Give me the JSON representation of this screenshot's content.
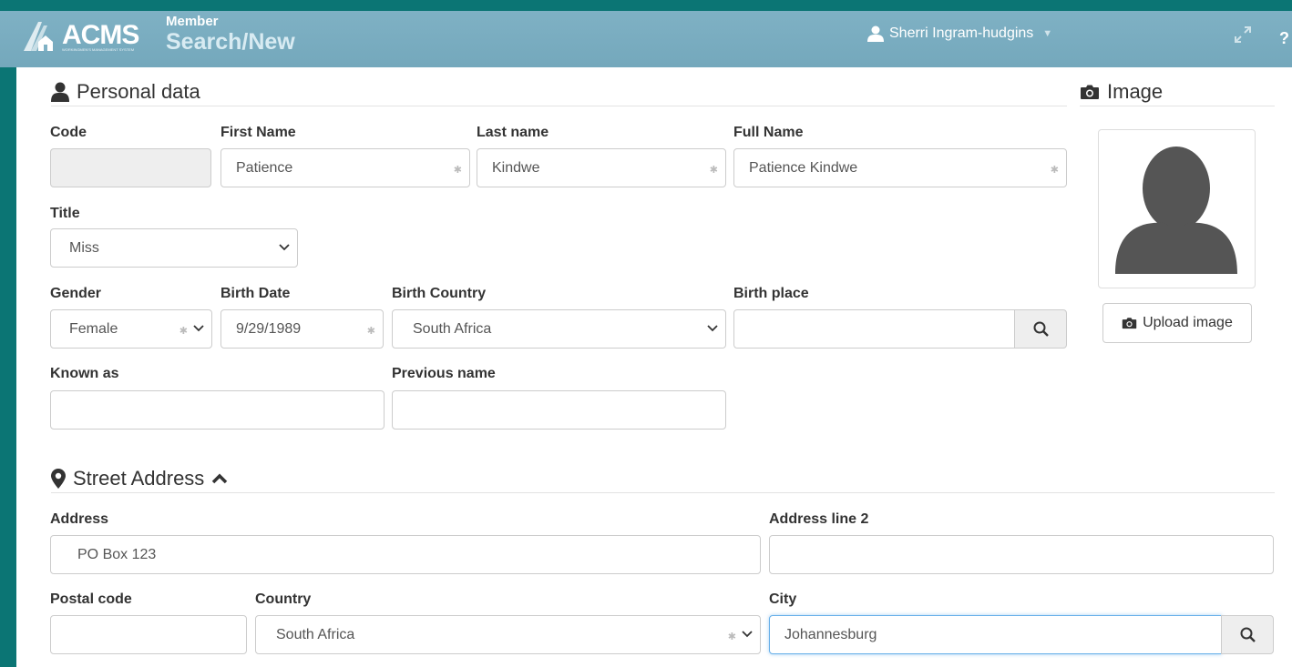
{
  "header": {
    "brand": "ACMS",
    "brand_tagline": "WORKINGMEN'S MANAGEMENT SYSTEM",
    "module_sub": "Member",
    "module_main": "Search/New",
    "user_name": "Sherri Ingram-hudgins",
    "help_label": "?"
  },
  "personal": {
    "section_title": "Personal data",
    "code": {
      "label": "Code",
      "value": ""
    },
    "first_name": {
      "label": "First Name",
      "value": "Patience",
      "required_mark": "✱"
    },
    "last_name": {
      "label": "Last name",
      "value": "Kindwe",
      "required_mark": "✱"
    },
    "full_name": {
      "label": "Full Name",
      "value": "Patience Kindwe",
      "required_mark": "✱"
    },
    "title": {
      "label": "Title",
      "value": "Miss"
    },
    "gender": {
      "label": "Gender",
      "value": "Female",
      "required_mark": "✱"
    },
    "birth_date": {
      "label": "Birth Date",
      "value": "9/29/1989",
      "required_mark": "✱"
    },
    "birth_country": {
      "label": "Birth Country",
      "value": "South Africa"
    },
    "birth_place": {
      "label": "Birth place",
      "value": ""
    },
    "known_as": {
      "label": "Known as",
      "value": ""
    },
    "previous_name": {
      "label": "Previous name",
      "value": ""
    }
  },
  "image": {
    "section_title": "Image",
    "upload_label": "Upload image"
  },
  "address": {
    "section_title": "Street Address",
    "address": {
      "label": "Address",
      "value": "PO Box 123"
    },
    "address_line2": {
      "label": "Address line 2",
      "value": ""
    },
    "postal_code": {
      "label": "Postal code",
      "value": ""
    },
    "country": {
      "label": "Country",
      "value": "South Africa",
      "required_mark": "✱"
    },
    "city": {
      "label": "City",
      "value": "Johannesburg"
    }
  },
  "colors": {
    "frame": "#0b7574",
    "header": "#7fb1c4",
    "focus": "#66afe9"
  }
}
